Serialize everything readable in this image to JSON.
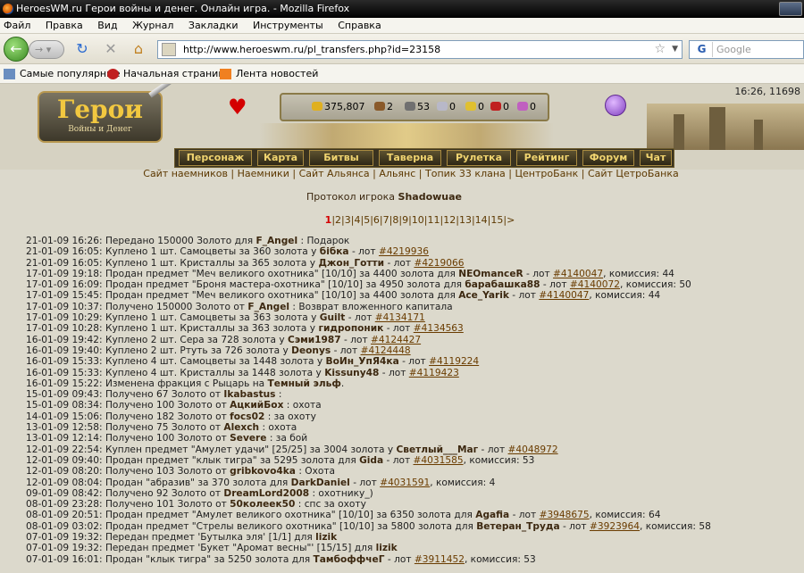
{
  "window": {
    "title": "HeroesWM.ru Герои войны и денег. Онлайн игра. - Mozilla Firefox"
  },
  "menu": [
    "Файл",
    "Правка",
    "Вид",
    "Журнал",
    "Закладки",
    "Инструменты",
    "Справка"
  ],
  "browser": {
    "url": "http://www.heroeswm.ru/pl_transfers.php?id=23158",
    "search_placeholder": "Google"
  },
  "bookmarks": [
    "Самые популярные",
    "Начальная страница",
    "Лента новостей"
  ],
  "game": {
    "logo_title": "Герои",
    "logo_subtitle": "Войны и Денег",
    "time_online": "16:26, 11698",
    "resources": [
      {
        "name": "gold",
        "value": "375,807",
        "color": "#e0b020"
      },
      {
        "name": "wood",
        "value": "2",
        "color": "#8a5a2a"
      },
      {
        "name": "ore",
        "value": "53",
        "color": "#707070"
      },
      {
        "name": "mercury",
        "value": "0",
        "color": "#b8b8c8"
      },
      {
        "name": "sulfur",
        "value": "0",
        "color": "#e0c030"
      },
      {
        "name": "crystals",
        "value": "0",
        "color": "#c02020"
      },
      {
        "name": "gems",
        "value": "0",
        "color": "#c060c0"
      }
    ],
    "nav": [
      "Персонаж",
      "Карта",
      "Битвы",
      "Таверна",
      "Рулетка",
      "Рейтинг",
      "Форум",
      "Чат"
    ],
    "links": [
      "Сайт наемников",
      "Наемники",
      "Сайт Альянса",
      "Альянс",
      "Топик 33 клана",
      "ЦентроБанк",
      "Сайт ЦетроБанка"
    ]
  },
  "protocol": {
    "label": "Протокол игрока",
    "player": "Shadowuae"
  },
  "pagination": {
    "current": "1",
    "pages": [
      "2",
      "3",
      "4",
      "5",
      "6",
      "7",
      "8",
      "9",
      "10",
      "11",
      "12",
      "13",
      "14",
      "15"
    ],
    "next": ">"
  },
  "log": [
    {
      "date": "21-01-09 16:26:",
      "text": "Передано 150000 Золото для",
      "who": "F_Angel",
      "tail": ": Подарок"
    },
    {
      "date": "21-01-09 16:05:",
      "text": "Куплено 1 шт. Самоцветы за 360 золота у",
      "who": "бібка",
      "tail": "- лот",
      "lot": "#4219936"
    },
    {
      "date": "21-01-09 16:05:",
      "text": "Куплено 1 шт. Кристаллы за 365 золота у",
      "who": "Джон_Готти",
      "tail": "- лот",
      "lot": "#4219066"
    },
    {
      "date": "17-01-09 19:18:",
      "text": "Продан предмет \"Меч великого охотника\" [10/10] за 4400 золота для",
      "who": "NEOmanceR",
      "tail": "- лот",
      "lot": "#4140047",
      "fee": ", комиссия: 44"
    },
    {
      "date": "17-01-09 16:09:",
      "text": "Продан предмет \"Броня мастера-охотника\" [10/10] за 4950 золота для",
      "who": "барабашка88",
      "tail": "- лот",
      "lot": "#4140072",
      "fee": ", комиссия: 50"
    },
    {
      "date": "17-01-09 15:45:",
      "text": "Продан предмет \"Меч великого охотника\" [10/10] за 4400 золота для",
      "who": "Ace_Yarik",
      "tail": "- лот",
      "lot": "#4140047",
      "fee": ", комиссия: 44"
    },
    {
      "date": "17-01-09 10:37:",
      "text": "Получено 150000 Золото от",
      "who": "F_Angel",
      "tail": ": Возврат вложенного капитала"
    },
    {
      "date": "17-01-09 10:29:",
      "text": "Куплено 1 шт. Самоцветы за 363 золота у",
      "who": "Guilt",
      "tail": "- лот",
      "lot": "#4134171"
    },
    {
      "date": "17-01-09 10:28:",
      "text": "Куплено 1 шт. Кристаллы за 363 золота у",
      "who": "гидропоник",
      "tail": "- лот",
      "lot": "#4134563"
    },
    {
      "date": "16-01-09 19:42:",
      "text": "Куплено 2 шт. Сера за 728 золота у",
      "who": "Сэми1987",
      "tail": "- лот",
      "lot": "#4124427"
    },
    {
      "date": "16-01-09 19:40:",
      "text": "Куплено 2 шт. Ртуть за 726 золота у",
      "who": "Deonys",
      "tail": "- лот",
      "lot": "#4124448"
    },
    {
      "date": "16-01-09 15:33:",
      "text": "Куплено 4 шт. Самоцветы за 1448 золота у",
      "who": "ВоИн_УпЯ4ка",
      "tail": "- лот",
      "lot": "#4119224"
    },
    {
      "date": "16-01-09 15:33:",
      "text": "Куплено 4 шт. Кристаллы за 1448 золота у",
      "who": "Kissuny48",
      "tail": "- лот",
      "lot": "#4119423"
    },
    {
      "date": "16-01-09 15:22:",
      "text": "Изменена фракция с Рыцарь на",
      "who": "Темный эльф",
      "tail": "."
    },
    {
      "date": "15-01-09 09:43:",
      "text": "Получено 67 Золото от",
      "who": "Ikabastus",
      "tail": ":"
    },
    {
      "date": "15-01-09 08:34:",
      "text": "Получено 100 Золото от",
      "who": "АцкийБох",
      "tail": ": охота"
    },
    {
      "date": "14-01-09 15:06:",
      "text": "Получено 182 Золото от",
      "who": "focs02",
      "tail": ": за охоту"
    },
    {
      "date": "13-01-09 12:58:",
      "text": "Получено 75 Золото от",
      "who": "Alexch",
      "tail": ": охота"
    },
    {
      "date": "13-01-09 12:14:",
      "text": "Получено 100 Золото от",
      "who": "Severe",
      "tail": ": за бой"
    },
    {
      "date": "12-01-09 22:54:",
      "text": "Куплен предмет \"Амулет удачи\" [25/25] за 3004 золота у",
      "who": "Светлый___Маг",
      "tail": "- лот",
      "lot": "#4048972"
    },
    {
      "date": "12-01-09 09:40:",
      "text": "Продан предмет \"клык тигра\" за 5295 золота для",
      "who": "Gida",
      "tail": "- лот",
      "lot": "#4031585",
      "fee": ", комиссия: 53"
    },
    {
      "date": "12-01-09 08:20:",
      "text": "Получено 103 Золото от",
      "who": "gribkovo4ka",
      "tail": ": Охота"
    },
    {
      "date": "12-01-09 08:04:",
      "text": "Продан \"абразив\" за 370 золота для",
      "who": "DarkDaniel",
      "tail": "- лот",
      "lot": "#4031591",
      "fee": ", комиссия: 4"
    },
    {
      "date": "09-01-09 08:42:",
      "text": "Получено 92 Золото от",
      "who": "DreamLord2008",
      "tail": ": охотнику_)"
    },
    {
      "date": "08-01-09 23:28:",
      "text": "Получено 101 Золото от",
      "who": "50колеек50",
      "tail": ": спс за охоту"
    },
    {
      "date": "08-01-09 20:51:",
      "text": "Продан предмет \"Амулет великого охотника\" [10/10] за 6350 золота для",
      "who": "Agafia",
      "tail": "- лот",
      "lot": "#3948675",
      "fee": ", комиссия: 64"
    },
    {
      "date": "08-01-09 03:02:",
      "text": "Продан предмет \"Стрелы великого охотника\" [10/10] за 5800 золота для",
      "who": "Ветеран_Труда",
      "tail": "- лот",
      "lot": "#3923964",
      "fee": ", комиссия: 58"
    },
    {
      "date": "07-01-09 19:32:",
      "text": "Передан предмет 'Бутылка эля' [1/1] для",
      "who": "lizik",
      "tail": ""
    },
    {
      "date": "07-01-09 19:32:",
      "text": "Передан предмет 'Букет \"Аромат весны\"' [15/15] для",
      "who": "lizik",
      "tail": ""
    },
    {
      "date": "07-01-09 16:01:",
      "text": "Продан \"клык тигра\" за 5250 золота для",
      "who": "ТамбоффчеГ",
      "tail": "- лот",
      "lot": "#3911452",
      "fee": ", комиссия: 53"
    }
  ]
}
